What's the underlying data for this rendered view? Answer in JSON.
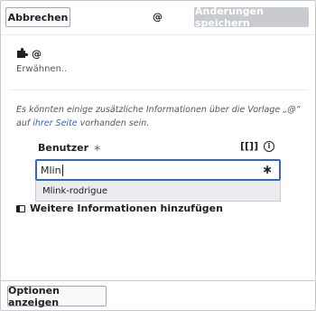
{
  "header": {
    "cancel_label": "Abbrechen",
    "title": "@",
    "save_label": "Änderungen speichern"
  },
  "template": {
    "icon": "puzzle-piece-icon",
    "name": "@",
    "description": "Erwähnen.."
  },
  "notice": {
    "text_before": "Es könnten einige zusätzliche Informationen über die Vorlage „@“ auf",
    "link_text": "ihrer Seite",
    "text_after": " vorhanden sein."
  },
  "parameter": {
    "label": "Benutzer",
    "required_marker": "∗",
    "tool_label": "[[]]",
    "info_icon": "i",
    "value": "Mlin",
    "input_star": "∗"
  },
  "suggestions": [
    {
      "label": "Mlink-rodrigue"
    }
  ],
  "more_info_label": "Weitere Informationen hinzufügen",
  "footer": {
    "options_label": "Optionen anzeigen"
  },
  "colors": {
    "link": "#3366cc",
    "focus_border": "#3366cc",
    "disabled_button": "#c8ccd1"
  }
}
